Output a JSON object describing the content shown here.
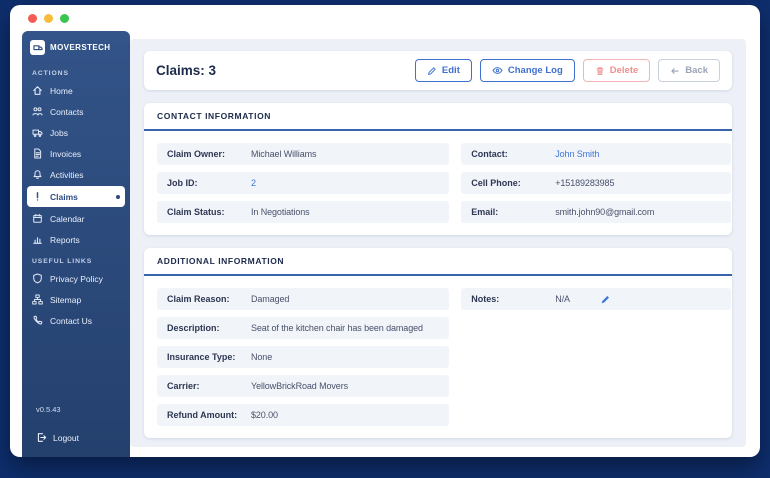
{
  "window": {
    "traffic_lights": {
      "close": "#f55c55",
      "minimize": "#f6bd3a",
      "maximize": "#3ac54f"
    }
  },
  "sidebar": {
    "logo": {
      "text": "MOVERSTECH"
    },
    "sections": [
      {
        "label": "ACTIONS",
        "items": [
          {
            "label": "Home"
          },
          {
            "label": "Contacts"
          },
          {
            "label": "Jobs"
          },
          {
            "label": "Invoices"
          },
          {
            "label": "Activities"
          },
          {
            "label": "Claims",
            "active": true
          },
          {
            "label": "Calendar"
          },
          {
            "label": "Reports"
          }
        ]
      },
      {
        "label": "USEFUL LINKS",
        "items": [
          {
            "label": "Privacy Policy"
          },
          {
            "label": "Sitemap"
          },
          {
            "label": "Contact Us"
          }
        ]
      }
    ],
    "version": "v0.5.43",
    "logout": "Logout"
  },
  "header": {
    "title": "Claims: 3",
    "buttons": {
      "edit": "Edit",
      "change_log": "Change Log",
      "delete": "Delete",
      "back": "Back"
    }
  },
  "contact_card": {
    "title": "CONTACT INFORMATION",
    "left": [
      {
        "label": "Claim Owner:",
        "value": "Michael Williams"
      },
      {
        "label": "Job ID:",
        "value": "2"
      },
      {
        "label": "Claim Status:",
        "value": "In Negotiations"
      }
    ],
    "right": [
      {
        "label": "Contact:",
        "value": "John Smith"
      },
      {
        "label": "Cell Phone:",
        "value": "+15189283985"
      },
      {
        "label": "Email:",
        "value": "smith.john90@gmail.com"
      }
    ]
  },
  "additional_card": {
    "title": "ADDITIONAL INFORMATION",
    "left": [
      {
        "label": "Claim Reason:",
        "value": "Damaged"
      },
      {
        "label": "Description:",
        "value": "Seat of the kitchen chair has been damaged"
      },
      {
        "label": "Insurance Type:",
        "value": "None"
      },
      {
        "label": "Carrier:",
        "value": "YellowBrickRoad Movers"
      },
      {
        "label": "Refund Amount:",
        "value": "$20.00"
      }
    ],
    "right": [
      {
        "label": "Notes:",
        "value": "N/A"
      }
    ]
  },
  "colors": {
    "frame": "#0e2e6d",
    "accent_blue": "#3f6fd1",
    "link_blue": "#3f76d9",
    "delete_red": "#ef8f8f",
    "card_header_border": "#3a63ae",
    "row_stripe": "#f1f4f9",
    "sidebar_top": "#335489",
    "sidebar_bottom": "#24406d"
  }
}
